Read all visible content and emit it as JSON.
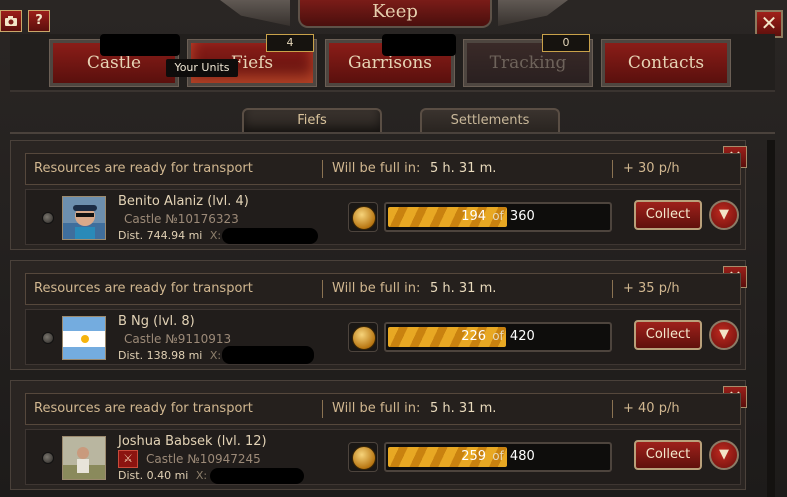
{
  "window": {
    "title": "Keep",
    "camera_icon": "camera-icon",
    "help_label": "?",
    "close_label": "✕"
  },
  "tabs": [
    {
      "label": "Castle",
      "badge": ""
    },
    {
      "label": "Fiefs",
      "badge": "4"
    },
    {
      "label": "Garrisons",
      "badge": ""
    },
    {
      "label": "Tracking",
      "badge": "0"
    },
    {
      "label": "Contacts",
      "badge": ""
    }
  ],
  "tooltip": "Your Units",
  "subtabs": [
    {
      "label": "Fiefs"
    },
    {
      "label": "Settlements"
    }
  ],
  "labels": {
    "ready": "Resources are ready for transport",
    "full_prefix": "Will be full in:",
    "collect": "Collect",
    "of": "of",
    "dist_prefix": "Dist.",
    "x_prefix": "X:",
    "close": "✕",
    "chevron": "▼"
  },
  "fiefs": [
    {
      "name": "Benito Alaniz (lvl. 4)",
      "castle": "Castle №10176323",
      "dist": "744.94 mi",
      "full_in": "5 h. 31 m.",
      "rate": "+ 30 p/h",
      "current": 194,
      "capacity": 360,
      "avatar": "photo-avatar"
    },
    {
      "name": "B Ng (lvl. 8)",
      "castle": "Castle №9110913",
      "dist": "138.98 mi",
      "full_in": "5 h. 31 m.",
      "rate": "+ 35 p/h",
      "current": 226,
      "capacity": 420,
      "avatar": "argentina-flag-avatar"
    },
    {
      "name": "Joshua Babsek (lvl. 12)",
      "castle": "Castle №10947245",
      "dist": "0.40 mi",
      "full_in": "5 h. 31 m.",
      "rate": "+ 40 p/h",
      "current": 259,
      "capacity": 480,
      "avatar": "photo-avatar"
    }
  ]
}
